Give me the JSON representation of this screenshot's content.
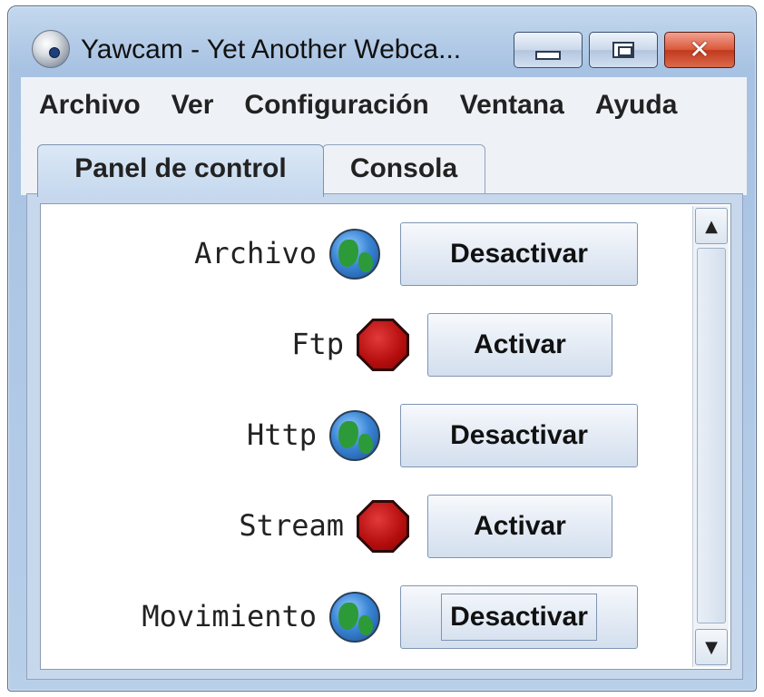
{
  "window": {
    "title": "Yawcam - Yet Another Webca...",
    "minimize_glyph": "",
    "maximize_glyph": "",
    "close_glyph": "✕"
  },
  "menu": {
    "items": [
      "Archivo",
      "Ver",
      "Configuración",
      "Ventana",
      "Ayuda"
    ]
  },
  "tabs": [
    {
      "label": "Panel de control",
      "active": true
    },
    {
      "label": "Consola",
      "active": false
    }
  ],
  "rows": [
    {
      "label": "Archivo",
      "status_icon": "globe-icon",
      "button": "Desactivar"
    },
    {
      "label": "Ftp",
      "status_icon": "stop-icon",
      "button": "Activar"
    },
    {
      "label": "Http",
      "status_icon": "globe-icon",
      "button": "Desactivar"
    },
    {
      "label": "Stream",
      "status_icon": "stop-icon",
      "button": "Activar"
    },
    {
      "label": "Movimiento",
      "status_icon": "globe-icon",
      "button": "Desactivar"
    }
  ],
  "scrollbar": {
    "up_glyph": "▲",
    "down_glyph": "▼"
  }
}
